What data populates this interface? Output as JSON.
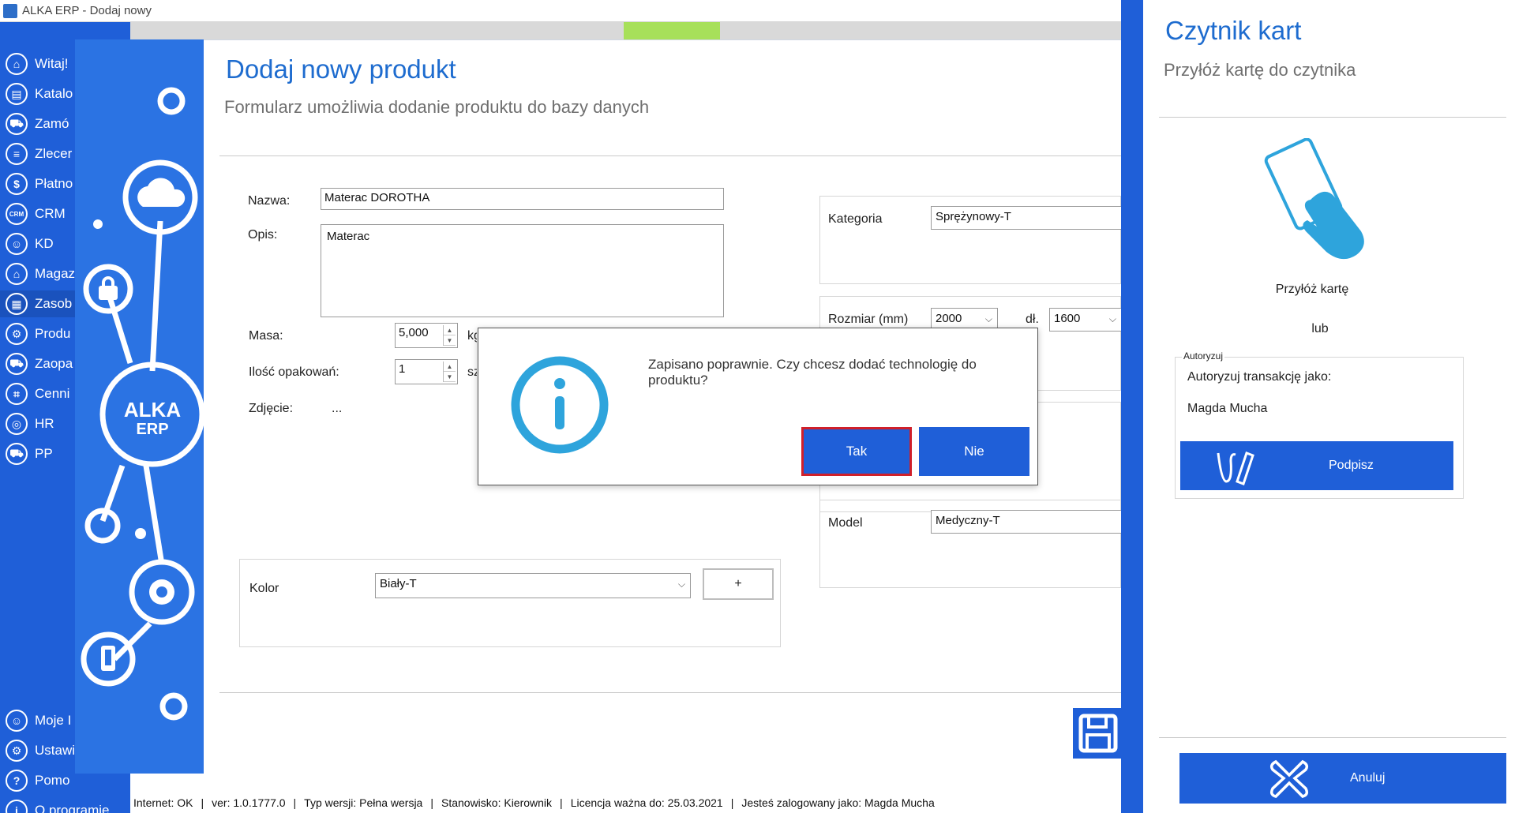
{
  "window": {
    "title": "ALKA ERP - Dodaj nowy"
  },
  "nav": {
    "items": [
      {
        "label": "Witaj!",
        "icon": "home-icon"
      },
      {
        "label": "Katalo",
        "icon": "book-icon"
      },
      {
        "label": "Zamó",
        "icon": "cart-icon"
      },
      {
        "label": "Zlecer",
        "icon": "list-icon"
      },
      {
        "label": "Płatno",
        "icon": "dollar-icon"
      },
      {
        "label": "CRM",
        "icon": "crm-icon"
      },
      {
        "label": "KD",
        "icon": "person-icon"
      },
      {
        "label": "Magaz",
        "icon": "warehouse-icon"
      },
      {
        "label": "Zasob",
        "icon": "resources-icon"
      },
      {
        "label": "Produ",
        "icon": "production-icon"
      },
      {
        "label": "Zaopa",
        "icon": "truck-icon"
      },
      {
        "label": "Cenni",
        "icon": "tag-icon"
      },
      {
        "label": "HR",
        "icon": "hr-icon"
      },
      {
        "label": "PP",
        "icon": "pp-icon"
      }
    ],
    "bottom_items": [
      {
        "label": "Moje I",
        "icon": "user-icon"
      },
      {
        "label": "Ustawi",
        "icon": "settings-icon"
      },
      {
        "label": "Pomo",
        "icon": "help-icon"
      },
      {
        "label": "O programie",
        "icon": "info-icon"
      }
    ]
  },
  "logo": {
    "line1": "ALKA",
    "line2": "ERP"
  },
  "form": {
    "title": "Dodaj nowy produkt",
    "subtitle": "Formularz umożliwia dodanie produktu do bazy danych",
    "nazwa_label": "Nazwa:",
    "nazwa_value": "Materac DOROTHA",
    "opis_label": "Opis:",
    "opis_value": "Materac",
    "masa_label": "Masa:",
    "masa_value": "5,000",
    "masa_unit": "kg",
    "ilosc_label": "Ilość opakowań:",
    "ilosc_value": "1",
    "ilosc_unit": "sz",
    "zdjecie_label": "Zdjęcie:",
    "zdjecie_value": "...",
    "kategoria_label": "Kategoria",
    "kategoria_value": "Sprężynowy-T",
    "rozmiar_label": "Rozmiar (mm)",
    "rozmiar_w": "2000",
    "dl_label": "dł.",
    "rozmiar_l": "1600",
    "model_label": "Model",
    "model_value": "Medyczny-T",
    "kolor_label": "Kolor",
    "kolor_value": "Biały-T",
    "add_label": "+"
  },
  "dialog": {
    "message": "Zapisano poprawnie. Czy chcesz dodać technologię do produktu?",
    "yes": "Tak",
    "no": "Nie"
  },
  "status": {
    "internet": "Internet: OK",
    "version": "ver: 1.0.1777.0",
    "type": "Typ wersji: Pełna wersja",
    "station": "Stanowisko: Kierownik",
    "license": "Licencja ważna do: 25.03.2021",
    "user": "Jesteś zalogowany jako: Magda Mucha"
  },
  "card_panel": {
    "title": "Czytnik kart",
    "subtitle": "Przyłóż kartę do czytnika",
    "tap_text": "Przyłóż kartę",
    "or_text": "lub",
    "legend": "Autoryzuj",
    "auth_as": "Autoryzuj transakcję jako:",
    "user": "Magda Mucha",
    "sign_button": "Podpisz",
    "cancel_button": "Anuluj"
  },
  "colors": {
    "accent": "#1f5fd8",
    "title_blue": "#1e6ccf",
    "danger_border": "#d0202a"
  }
}
